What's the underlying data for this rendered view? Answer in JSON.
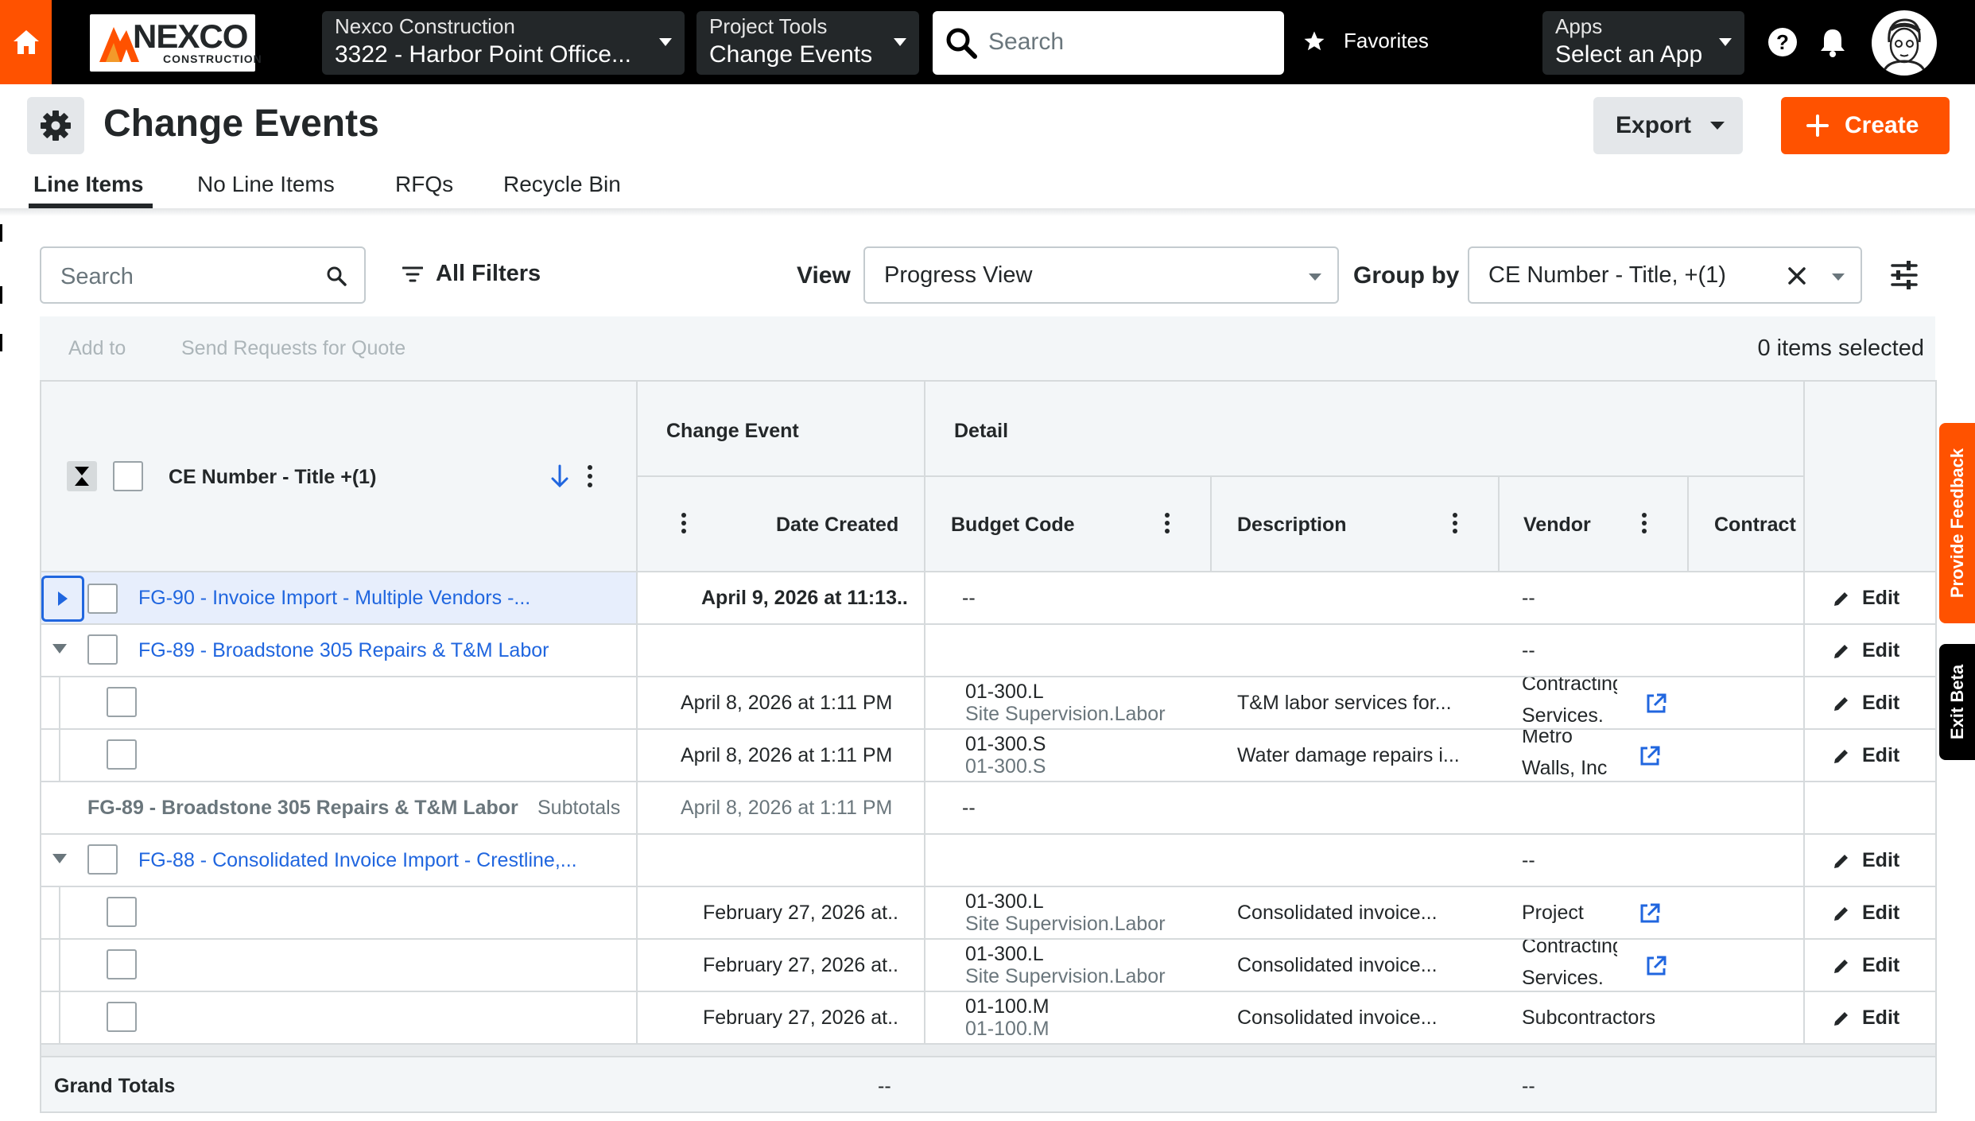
{
  "topbar": {
    "company_dd": {
      "label": "Nexco Construction",
      "value": "3322 - Harbor Point Office..."
    },
    "tools_dd": {
      "label": "Project Tools",
      "value": "Change Events"
    },
    "search_placeholder": "Search",
    "favorites_label": "Favorites",
    "apps_dd": {
      "label": "Apps",
      "value": "Select an App"
    },
    "logo": {
      "name": "NEXCO",
      "sub": "CONSTRUCTION"
    }
  },
  "header": {
    "title": "Change Events",
    "export_label": "Export",
    "create_label": "Create",
    "tabs": [
      "Line Items",
      "No Line Items",
      "RFQs",
      "Recycle Bin"
    ]
  },
  "toolbar": {
    "search_placeholder": "Search",
    "all_filters": "All Filters",
    "view_label": "View",
    "view_value": "Progress View",
    "group_label": "Group by",
    "group_value": "CE Number - Title, +(1)"
  },
  "bulk": {
    "add_to": "Add to",
    "send_rfq": "Send Requests for Quote",
    "selected": "0 items selected"
  },
  "grid": {
    "group_header": "CE Number - Title +(1)",
    "col_groups": [
      "Change Event",
      "Detail"
    ],
    "columns": [
      "Date Created",
      "Budget Code",
      "Description",
      "Vendor",
      "Contract"
    ],
    "edit_label": "Edit",
    "rows": [
      {
        "group": "FG-90 - Invoice Import - Multiple Vendors -...",
        "date": "April 9, 2026 at 11:13..",
        "budget": "--",
        "vendor": "--"
      },
      {
        "group": "FG-89 - Broadstone 305 Repairs & T&M Labor",
        "vendor": "--"
      },
      {
        "date": "April 8, 2026 at 1:11 PM",
        "budget1": "01-300.L",
        "budget2": "Site Supervision.Labor",
        "desc": "T&M labor services for...",
        "vendor1": "Contracting",
        "vendor2": "Services."
      },
      {
        "date": "April 8, 2026 at 1:11 PM",
        "budget1": "01-300.S",
        "budget2": "01-300.S",
        "desc": "Water damage repairs i...",
        "vendor1": "Metro",
        "vendor2": "Walls, Inc"
      },
      {
        "subtotal_title": "FG-89 - Broadstone 305 Repairs & T&M Labor",
        "subtotal_label": "Subtotals",
        "date": "April 8, 2026 at 1:11 PM",
        "budget": "--"
      },
      {
        "group": "FG-88 - Consolidated Invoice Import - Crestline,...",
        "vendor": "--"
      },
      {
        "date": "February 27, 2026 at..",
        "budget1": "01-300.L",
        "budget2": "Site Supervision.Labor",
        "desc": "Consolidated invoice...",
        "vendor": "Project"
      },
      {
        "date": "February 27, 2026 at..",
        "budget1": "01-300.L",
        "budget2": "Site Supervision.Labor",
        "desc": "Consolidated invoice...",
        "vendor1": "Contracting",
        "vendor2": "Services."
      },
      {
        "date": "February 27, 2026 at..",
        "budget1": "01-100.M",
        "budget2": "01-100.M",
        "desc": "Consolidated invoice...",
        "vendor": "Subcontractors"
      }
    ],
    "grand_totals": {
      "label": "Grand Totals",
      "date": "--",
      "vendor": "--"
    }
  },
  "side": {
    "feedback": "Provide Feedback",
    "beta": "Exit Beta"
  },
  "colors": {
    "brand": "#ff5200",
    "link": "#2066df",
    "topbar": "#000000"
  }
}
